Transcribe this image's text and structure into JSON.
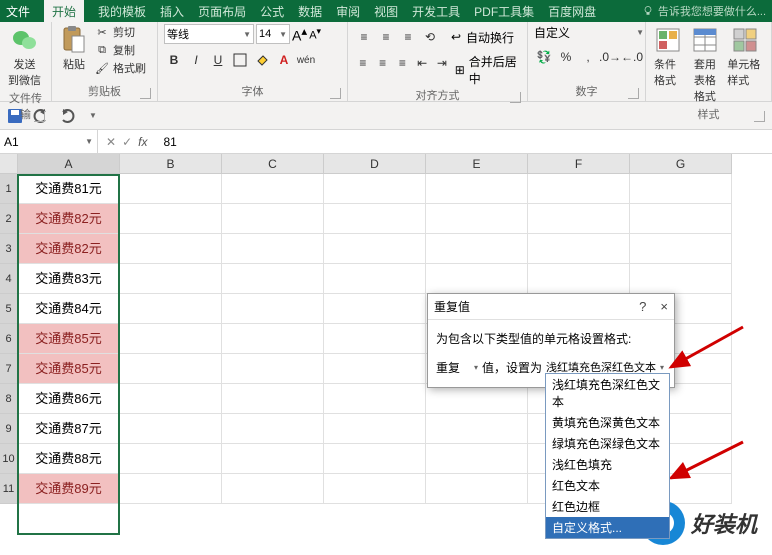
{
  "titlebar": {
    "tabs": [
      "文件",
      "开始",
      "我的模板",
      "插入",
      "页面布局",
      "公式",
      "数据",
      "审阅",
      "视图",
      "开发工具",
      "PDF工具集",
      "百度网盘"
    ],
    "active_index": 1,
    "tell_me": "告诉我您想要做什么..."
  },
  "ribbon": {
    "g0": {
      "label": "文件传输",
      "btn": "发送\n到微信"
    },
    "g1": {
      "label": "剪贴板",
      "paste": "粘贴",
      "cut": "剪切",
      "copy": "复制",
      "painter": "格式刷"
    },
    "g2": {
      "label": "字体",
      "font_name": "等线",
      "font_size": "14",
      "aa": "A",
      "btns": [
        "B",
        "I",
        "U"
      ]
    },
    "g3": {
      "label": "对齐方式",
      "wrap": "自动换行",
      "merge": "合并后居中"
    },
    "g4": {
      "label": "数字",
      "format": "自定义"
    },
    "g5": {
      "label": "样式",
      "cond": "条件格式",
      "table": "套用\n表格格式",
      "cell": "单元格样式"
    }
  },
  "namebox": "A1",
  "formula": "81",
  "columns": [
    "A",
    "B",
    "C",
    "D",
    "E",
    "F",
    "G"
  ],
  "rows": [
    {
      "n": "1",
      "a": "交通费81元",
      "dup": false
    },
    {
      "n": "2",
      "a": "交通费82元",
      "dup": true
    },
    {
      "n": "3",
      "a": "交通费82元",
      "dup": true
    },
    {
      "n": "4",
      "a": "交通费83元",
      "dup": false
    },
    {
      "n": "5",
      "a": "交通费84元",
      "dup": false
    },
    {
      "n": "6",
      "a": "交通费85元",
      "dup": true
    },
    {
      "n": "7",
      "a": "交通费85元",
      "dup": true
    },
    {
      "n": "8",
      "a": "交通费86元",
      "dup": false
    },
    {
      "n": "9",
      "a": "交通费87元",
      "dup": false
    },
    {
      "n": "10",
      "a": "交通费88元",
      "dup": false
    },
    {
      "n": "11",
      "a": "交通费89元",
      "dup": true
    }
  ],
  "dialog": {
    "title": "重复值",
    "help": "?",
    "close": "×",
    "prompt": "为包含以下类型值的单元格设置格式:",
    "type_sel": "重复",
    "mid": "值，设置为",
    "style_sel": "浅红填充色深红色文本",
    "options": [
      "浅红填充色深红色文本",
      "黄填充色深黄色文本",
      "绿填充色深绿色文本",
      "浅红色填充",
      "红色文本",
      "红色边框",
      "自定义格式..."
    ],
    "highlight_index": 6
  },
  "watermark": "好装机"
}
